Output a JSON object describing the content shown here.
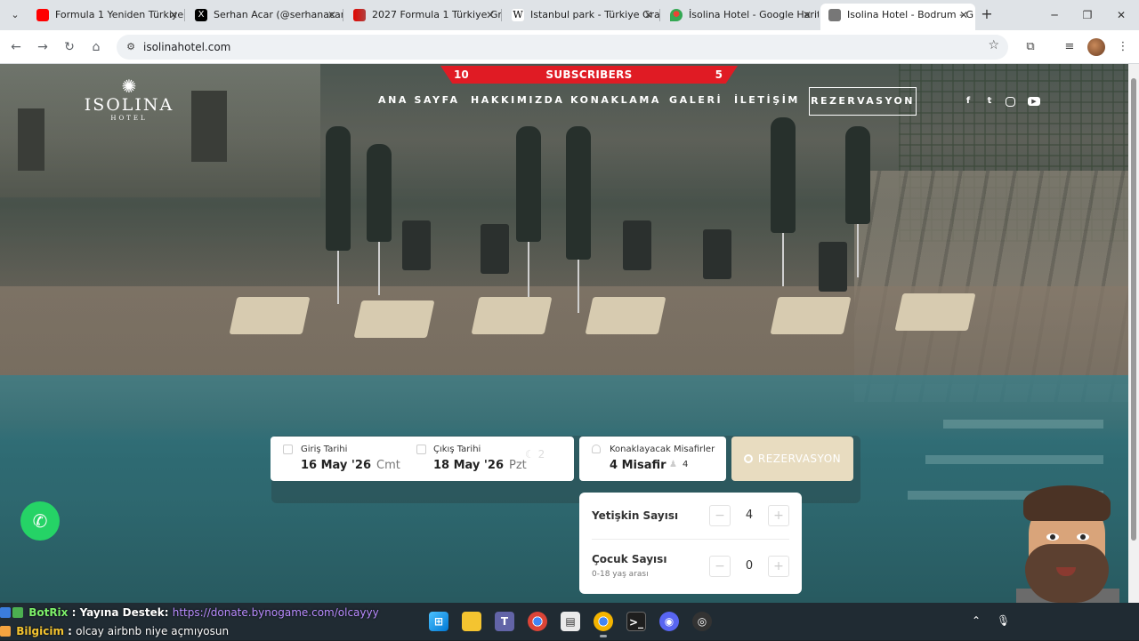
{
  "browser": {
    "tabs": [
      {
        "title": "Formula 1 Yeniden Türkiye",
        "icon": "youtube-icon",
        "color": "#ff0000",
        "active": false
      },
      {
        "title": "Serhan Acar (@serhanacar",
        "icon": "x-icon",
        "color": "#000000",
        "active": false
      },
      {
        "title": "2027 Formula 1 Türkiye Gr",
        "icon": "f1-icon",
        "color": "#e10600",
        "active": false
      },
      {
        "title": "Istanbul park - Türkiye Gra",
        "icon": "wikipedia-icon",
        "color": "#ffffff",
        "active": false
      },
      {
        "title": "İsolina Hotel - Google Harit",
        "icon": "google-maps-icon",
        "color": "#34a853",
        "active": false
      },
      {
        "title": "Isolina Hotel - Bodrum - G",
        "icon": "globe-icon",
        "color": "#555555",
        "active": true
      }
    ],
    "url": "isolinahotel.com"
  },
  "site": {
    "banner": {
      "left": "10",
      "center": "SUBSCRIBERS",
      "right": "5"
    },
    "logo": {
      "name": "ISOLINA",
      "sub": "HOTEL"
    },
    "menu": [
      "ANA SAYFA",
      "HAKKIMIZDA",
      "KONAKLAMA",
      "GALERİ",
      "İLETİŞİM"
    ],
    "cta": "REZERVASYON",
    "social": [
      "facebook-icon",
      "twitter-icon",
      "instagram-icon",
      "youtube-icon"
    ],
    "booking": {
      "checkin_label": "Giriş Tarihi",
      "checkin_value": "16 May '26",
      "checkin_day": "Cmt",
      "checkout_label": "Çıkış Tarihi",
      "checkout_value": "18 May '26",
      "checkout_day": "Pzt",
      "nights": "2",
      "guests_label": "Konaklayacak Misafirler",
      "guests_value": "4 Misafir",
      "guests_count": "4",
      "search_label": "REZERVASYON"
    },
    "guest_panel": {
      "adults_label": "Yetişkin Sayısı",
      "adults_value": "4",
      "children_label": "Çocuk Sayısı",
      "children_sub": "0-18 yaş arası",
      "children_value": "0"
    }
  },
  "chat": [
    {
      "user": "BotRix",
      "text": "Yayına Destek:",
      "link": "https://donate.bynogame.com/olcayyy"
    },
    {
      "user": "Bilgicim",
      "text": "olcay airbnb niye açmıyosun",
      "link": ""
    }
  ]
}
